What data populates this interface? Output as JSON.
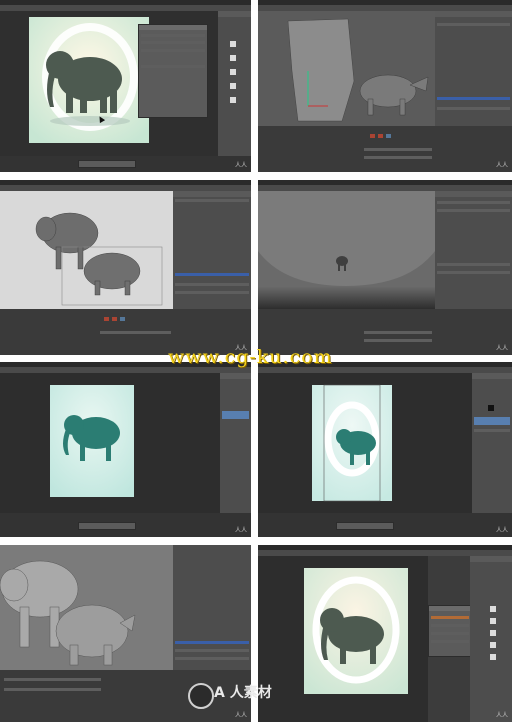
{
  "panels": [
    {
      "id": "panel-1",
      "description": "Photoshop-like canvas with elephant artwork"
    },
    {
      "id": "panel-2",
      "description": "3D modeling viewport with elephant and rhinoceros"
    },
    {
      "id": "panel-3",
      "description": "3D viewport with elephant and rhinoceros models and spline"
    },
    {
      "id": "panel-4",
      "description": "3D viewport with floor backdrop and small elephant"
    },
    {
      "id": "panel-5",
      "description": "Photoshop-like canvas with teal elephant render"
    },
    {
      "id": "panel-6",
      "description": "Photoshop-like canvas with teal elephant and crop guides"
    },
    {
      "id": "panel-7",
      "description": "3D viewport with large grey elephant and rhinoceros"
    },
    {
      "id": "panel-8",
      "description": "Photoshop-like canvas with final elephant composite and layers panel"
    }
  ],
  "overlays": {
    "watermark_text": "www.cg-ku.com",
    "logo_text": "A 人素材",
    "corner_mark": "人人"
  },
  "colors": {
    "ui_dark": "#3c3c3c",
    "ui_mid": "#4d4d4d",
    "ui_light": "#5e5e5e",
    "teal_bg": "#e6f4ee",
    "watermark": "#f4d21a"
  }
}
